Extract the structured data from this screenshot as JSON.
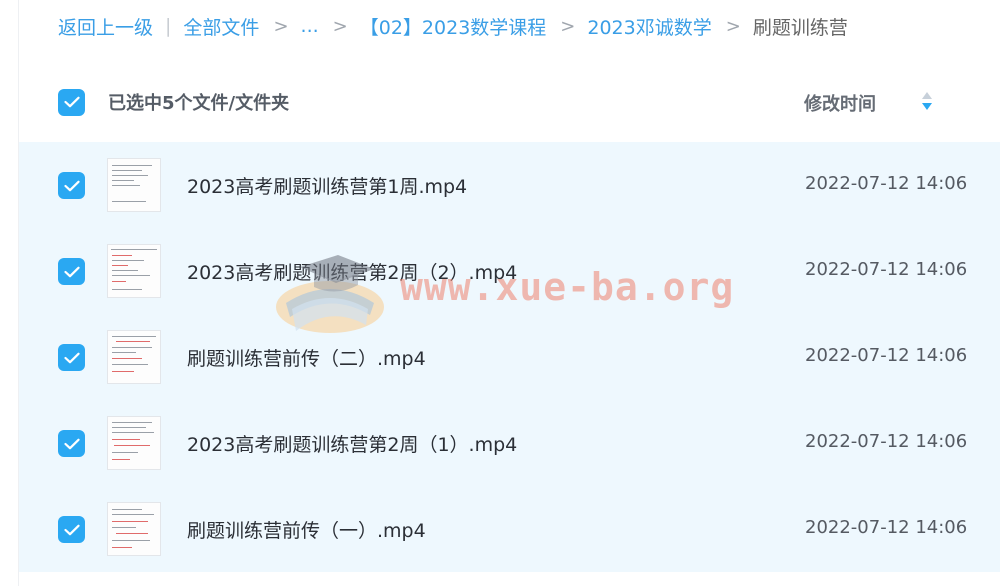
{
  "breadcrumb": {
    "back": "返回上一级",
    "pipe": "|",
    "items": [
      {
        "label": "全部文件"
      },
      {
        "label": "..."
      },
      {
        "label": "【02】2023数学课程"
      },
      {
        "label": "2023邓诚数学"
      }
    ],
    "current": "刷题训练营",
    "separator": ">"
  },
  "header": {
    "selected_text": "已选中5个文件/文件夹",
    "modified_label": "修改时间"
  },
  "files": [
    {
      "name": "2023高考刷题训练营第1周.mp4",
      "time": "2022-07-12 14:06"
    },
    {
      "name": "2023高考刷题训练营第2周（2）.mp4",
      "time": "2022-07-12 14:06"
    },
    {
      "name": "刷题训练营前传（二）.mp4",
      "time": "2022-07-12 14:06"
    },
    {
      "name": "2023高考刷题训练营第2周（1）.mp4",
      "time": "2022-07-12 14:06"
    },
    {
      "name": "刷题训练营前传（一）.mp4",
      "time": "2022-07-12 14:06"
    }
  ],
  "watermark": {
    "text": "www.xue-ba.org",
    "icon": "graduation-cap-book-icon"
  },
  "colors": {
    "accent": "#2aa8f2",
    "link": "#3a9ee6",
    "row_bg": "#eef8fe",
    "watermark": "#ee826e"
  },
  "icons": {
    "checkbox": "checkmark-icon",
    "sort": "sort-arrows-icon",
    "thumbnail": "video-thumbnail"
  }
}
